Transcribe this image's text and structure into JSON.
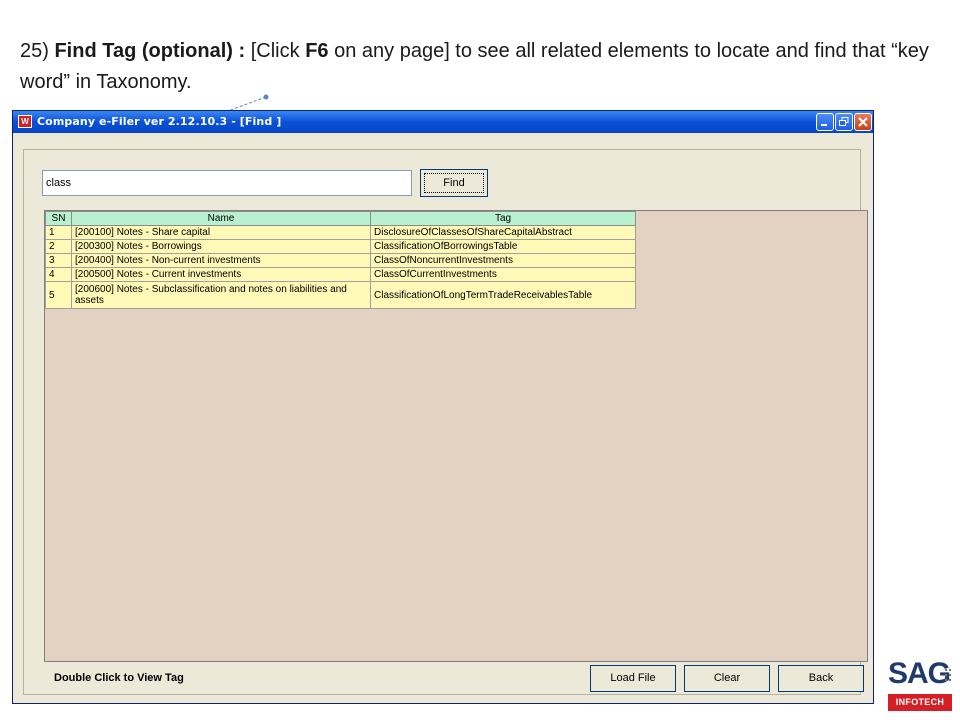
{
  "caption": {
    "num": "25)",
    "title": "Find Tag (optional) :",
    "pre": "[Click",
    "key": "F6",
    "rest": "on any page]  to see all related elements to locate and find that “key word” in Taxonomy."
  },
  "window": {
    "title": "Company e-Filer ver 2.12.10.3 - [Find ]",
    "app_icon_text": "W",
    "search": {
      "value": "class"
    },
    "find_label": "Find",
    "table": {
      "headers": [
        "SN",
        "Name",
        "Tag"
      ],
      "rows": [
        {
          "sn": "1",
          "name": "[200100] Notes - Share capital",
          "tag": "DisclosureOfClassesOfShareCapitalAbstract"
        },
        {
          "sn": "2",
          "name": "[200300] Notes - Borrowings",
          "tag": "ClassificationOfBorrowingsTable"
        },
        {
          "sn": "3",
          "name": "[200400] Notes - Non-current investments",
          "tag": "ClassOfNoncurrentInvestments"
        },
        {
          "sn": "4",
          "name": "[200500] Notes - Current investments",
          "tag": "ClassOfCurrentInvestments"
        },
        {
          "sn": "5",
          "name": "[200600] Notes - Subclassification and notes on liabilities and assets",
          "tag": "ClassificationOfLongTermTradeReceivablesTable"
        }
      ]
    },
    "hint": "Double Click to View Tag",
    "buttons": {
      "load_file": "Load File",
      "clear": "Clear",
      "back": "Back"
    }
  },
  "logo": {
    "name": "SAG",
    "sub": "INFOTECH",
    "colors": {
      "name": "#1f3a6b",
      "bar": "#d41f26"
    }
  }
}
